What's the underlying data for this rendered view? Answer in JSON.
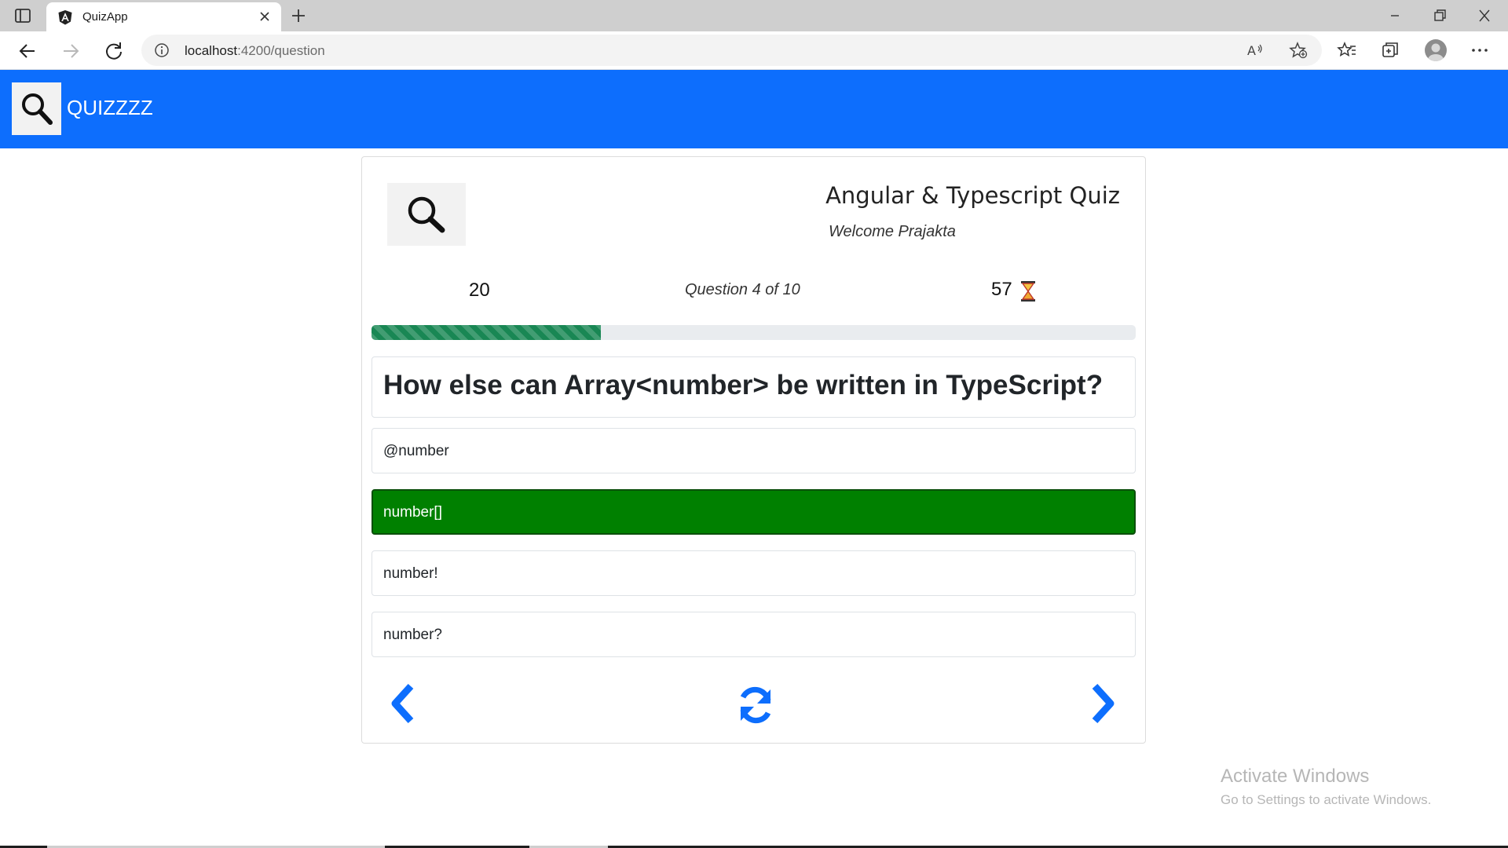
{
  "browser": {
    "tab_title": "QuizApp",
    "url_host": "localhost",
    "url_path": ":4200/question",
    "icons": [
      "sidebar-icon",
      "angular-icon",
      "close-icon",
      "plus-icon",
      "back-icon",
      "forward-icon",
      "reload-icon",
      "info-icon",
      "read-aloud-icon",
      "add-favorite-icon",
      "favorites-icon",
      "collections-icon",
      "profile-icon",
      "more-icon",
      "minimize-icon",
      "restore-icon",
      "window-close-icon"
    ]
  },
  "navbar": {
    "brand": "QUIZZZZ",
    "color": "#0d6efd",
    "logo_icon": "magnifier-icon"
  },
  "quiz": {
    "title": "Angular & Typescript Quiz",
    "welcome": "Welcome Prajakta",
    "score": "20",
    "question_counter": "Question 4 of 10",
    "timer": "57",
    "timer_icon": "hourglass-icon",
    "progress_fraction": 0.3,
    "progress_color": "#198754",
    "question": "How else can Array<number> be written in TypeScript?",
    "options": [
      "@number",
      "number[]",
      "number!",
      "number?"
    ],
    "selected_option_index": 1,
    "selected_color": "#008000",
    "controls": {
      "prev_icon": "chevron-left-icon",
      "reset_icon": "refresh-icon",
      "next_icon": "chevron-right-icon",
      "color": "#0d6efd"
    }
  },
  "watermark": {
    "title": "Activate Windows",
    "subtitle": "Go to Settings to activate Windows."
  }
}
